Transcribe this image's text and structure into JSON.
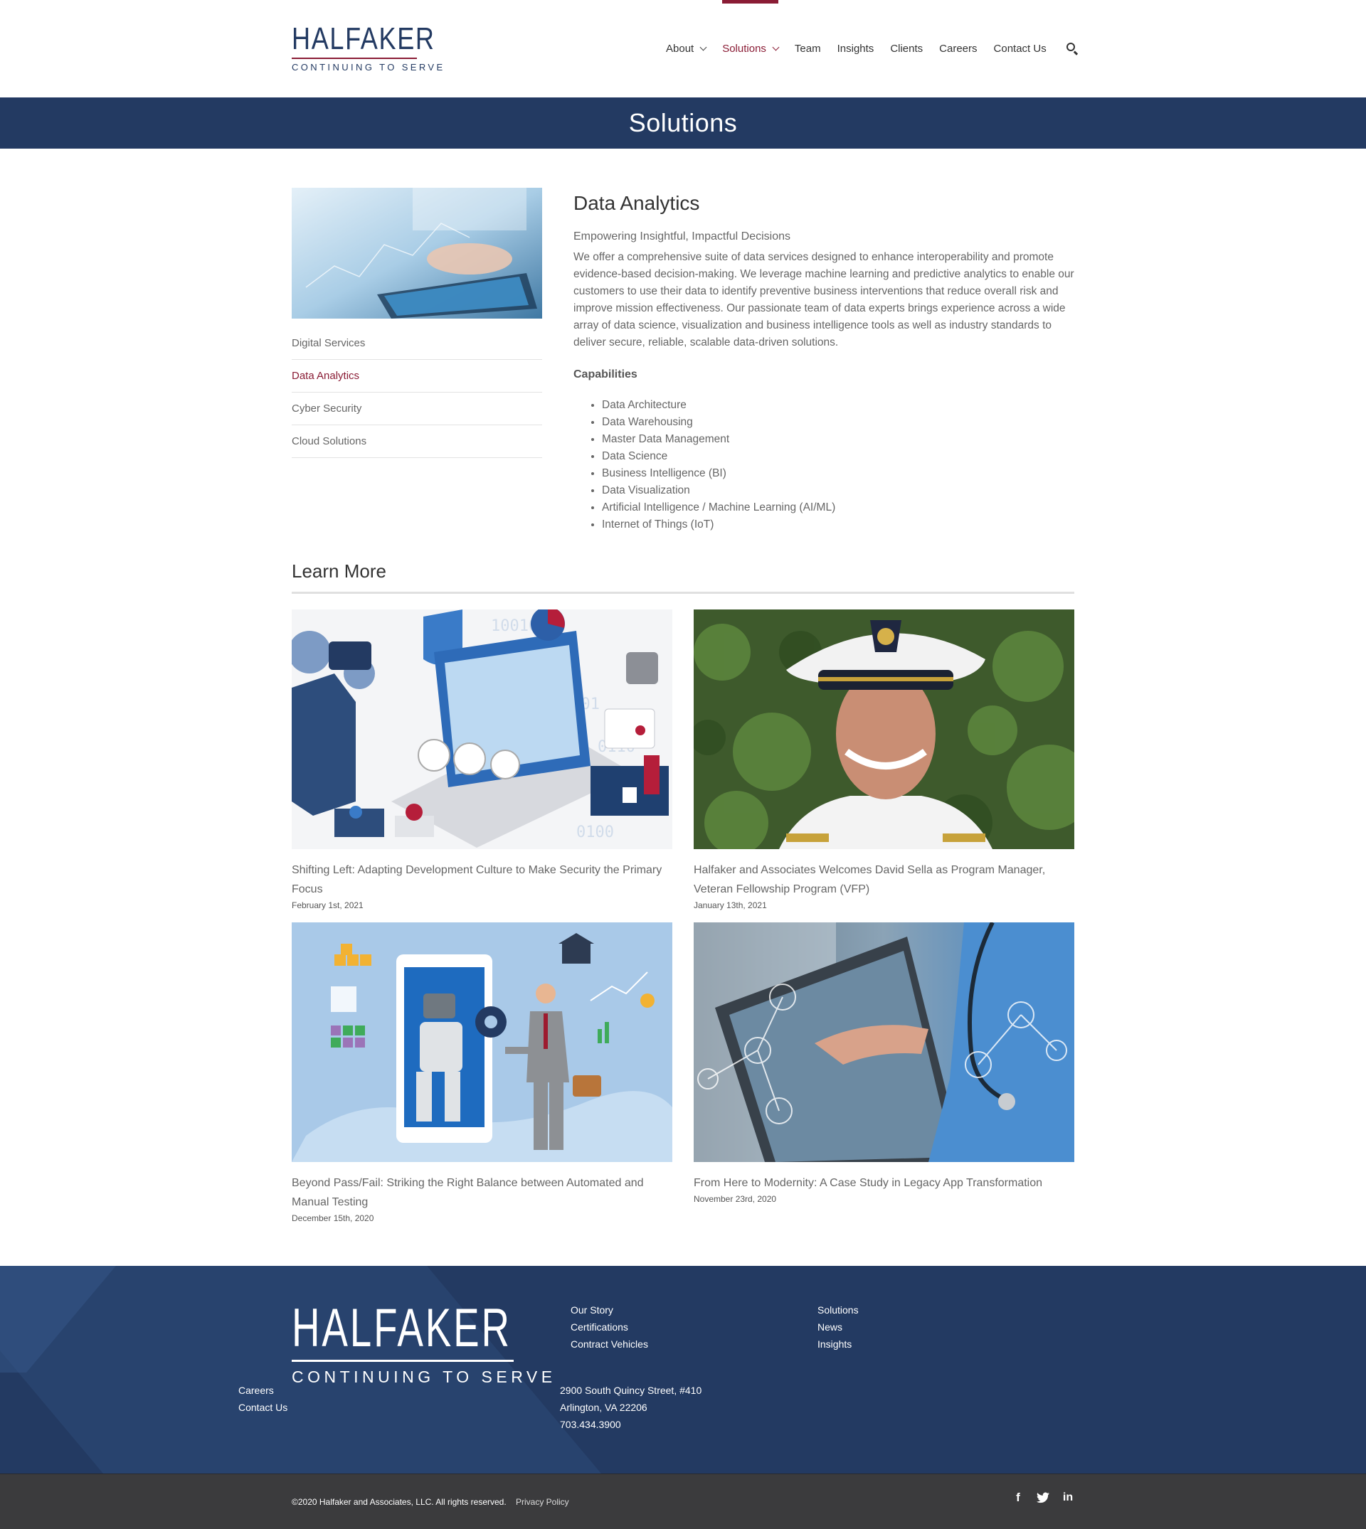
{
  "brand": {
    "name": "HALFAKER",
    "tagline": "CONTINUING TO SERVE",
    "colors": {
      "navy": "#233a62",
      "accent": "#8a1c35",
      "footer_bottom": "#3b3b3d"
    }
  },
  "nav": {
    "items": [
      {
        "label": "About",
        "has_dropdown": true,
        "active": false
      },
      {
        "label": "Solutions",
        "has_dropdown": true,
        "active": true
      },
      {
        "label": "Team",
        "has_dropdown": false,
        "active": false
      },
      {
        "label": "Insights",
        "has_dropdown": false,
        "active": false
      },
      {
        "label": "Clients",
        "has_dropdown": false,
        "active": false
      },
      {
        "label": "Careers",
        "has_dropdown": false,
        "active": false
      },
      {
        "label": "Contact Us",
        "has_dropdown": false,
        "active": false
      }
    ],
    "search_icon": "search-icon"
  },
  "page_title": "Solutions",
  "sidebar": {
    "image_icon": "tablet-analytics-photo",
    "links": [
      {
        "label": "Digital Services",
        "active": false
      },
      {
        "label": "Data Analytics",
        "active": true
      },
      {
        "label": "Cyber Security",
        "active": false
      },
      {
        "label": "Cloud Solutions",
        "active": false
      }
    ]
  },
  "main": {
    "heading": "Data Analytics",
    "subheading": "Empowering Insightful, Impactful Decisions",
    "description": "We offer a comprehensive suite of data services designed to enhance interoperability and promote evidence-based decision-making. We leverage machine learning and predictive analytics to enable our customers to use their data to identify preventive business interventions that reduce overall risk and improve mission effectiveness. Our passionate team of data experts brings experience across a wide array of data science, visualization and business intelligence tools as well as industry standards to deliver secure, reliable, scalable data-driven solutions.",
    "capabilities_title": "Capabilities",
    "capabilities": [
      "Data Architecture",
      "Data Warehousing",
      "Master Data Management",
      "Data Science",
      "Business Intelligence (BI)",
      "Data Visualization",
      "Artificial Intelligence / Machine Learning (AI/ML)",
      "Internet of Things (IoT)"
    ]
  },
  "learn_more": {
    "title": "Learn More",
    "cards": [
      {
        "title": "Shifting Left: Adapting Development Culture to Make Security the Primary Focus",
        "date": "February 1st, 2021"
      },
      {
        "title": "Halfaker and Associates Welcomes David Sella as Program Manager, Veteran Fellowship Program (VFP)",
        "date": "January 13th, 2021"
      },
      {
        "title": "Beyond Pass/Fail: Striking the Right Balance between Automated and Manual Testing",
        "date": "December 15th, 2020"
      },
      {
        "title": "From Here to Modernity: A Case Study in Legacy App Transformation",
        "date": "November 23rd, 2020"
      }
    ]
  },
  "footer": {
    "col1": [
      "Careers",
      "Contact Us"
    ],
    "col2": [
      "Our Story",
      "Certifications",
      "Contract Vehicles"
    ],
    "col3": [
      "Solutions",
      "News",
      "Insights"
    ],
    "address": [
      "2900 South Quincy Street, #410",
      "Arlington, VA 22206",
      "703.434.3900"
    ],
    "copyright": "©2020 Halfaker and Associates, LLC. All rights reserved.",
    "privacy": "Privacy Policy",
    "social": [
      "facebook-icon",
      "twitter-icon",
      "linkedin-icon"
    ]
  }
}
